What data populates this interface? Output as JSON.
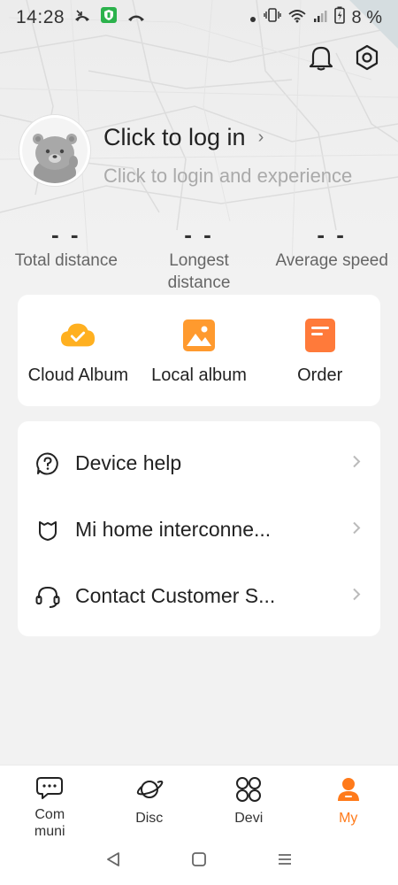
{
  "status_bar": {
    "time": "14:28",
    "battery": "8 %"
  },
  "profile": {
    "login_title": "Click to log in",
    "login_chevron": "›",
    "login_subtitle": "Click to login and experience"
  },
  "stats": [
    {
      "value": "- -",
      "label": "Total distance"
    },
    {
      "value": "- -",
      "label": "Longest distance"
    },
    {
      "value": "- -",
      "label": "Average speed"
    }
  ],
  "quick_actions": [
    {
      "label": "Cloud Album",
      "icon": "cloud-check-icon",
      "color": "#ffb020"
    },
    {
      "label": "Local album",
      "icon": "image-icon",
      "color": "#ff9a2e"
    },
    {
      "label": "Order",
      "icon": "order-icon",
      "color": "#ff7a3a"
    }
  ],
  "menu": [
    {
      "label": "Device help",
      "icon": "question-icon"
    },
    {
      "label": "Mi home interconne...",
      "icon": "mi-home-icon"
    },
    {
      "label": "Contact Customer S...",
      "icon": "headset-icon"
    }
  ],
  "bottom_nav": [
    {
      "label": "Com muni",
      "icon": "community-icon"
    },
    {
      "label": "Disc",
      "icon": "planet-icon"
    },
    {
      "label": "Devi",
      "icon": "devices-icon"
    },
    {
      "label": "My",
      "icon": "person-icon",
      "active": true
    }
  ],
  "colors": {
    "accent": "#ff7a1a",
    "background": "#f2f2f2"
  }
}
